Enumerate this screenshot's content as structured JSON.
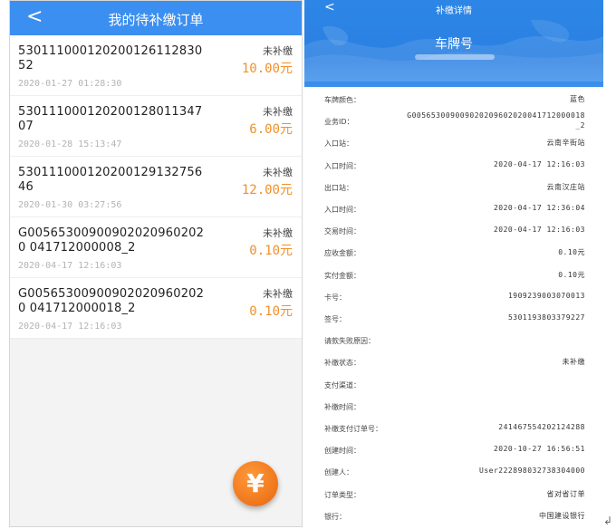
{
  "left": {
    "back_glyph": "<",
    "title": "我的待补缴订单",
    "orders": [
      {
        "id": "530111000120200126112830 52",
        "time": "2020-01-27 01:28:30",
        "status": "未补缴",
        "amount": "10.00元"
      },
      {
        "id": "530111000120200128011347 07",
        "time": "2020-01-28 15:13:47",
        "status": "未补缴",
        "amount": "6.00元"
      },
      {
        "id": "530111000120200129132756 46",
        "time": "2020-01-30 03:27:56",
        "status": "未补缴",
        "amount": "12.00元"
      },
      {
        "id": "G005653009009020209602020 041712000008_2",
        "time": "2020-04-17 12:16:03",
        "status": "未补缴",
        "amount": "0.10元"
      },
      {
        "id": "G005653009009020209602020 041712000018_2",
        "time": "2020-04-17 12:16:03",
        "status": "未补缴",
        "amount": "0.10元"
      }
    ],
    "fab_icon": "yen-icon",
    "fab_glyph": "¥",
    "accent_color": "#3b8ff0",
    "amount_color": "#f0902a"
  },
  "right": {
    "back_glyph": "<",
    "title": "补缴详情",
    "plate_heading": "车牌号",
    "details": [
      {
        "label": "车牌颜色：",
        "value": "蓝色"
      },
      {
        "label": "业务ID：",
        "value": "G005653009009020209602020041712000018_2"
      },
      {
        "label": "入口站：",
        "value": "云南辛街站"
      },
      {
        "label": "入口时间：",
        "value": "2020-04-17 12:16:03"
      },
      {
        "label": "出口站：",
        "value": "云南汉庄站"
      },
      {
        "label": "入口时间：",
        "value": "2020-04-17 12:36:04"
      },
      {
        "label": "交易时间：",
        "value": "2020-04-17 12:16:03"
      },
      {
        "label": "应收金额：",
        "value": "0.10元"
      },
      {
        "label": "实付金额：",
        "value": "0.10元"
      },
      {
        "label": "卡号：",
        "value": "1909239003070013"
      },
      {
        "label": "签号：",
        "value": "5301193803379227"
      },
      {
        "label": "请款失败原因：",
        "value": ""
      },
      {
        "label": "补缴状态：",
        "value": "未补缴"
      },
      {
        "label": "支付渠道：",
        "value": ""
      },
      {
        "label": "补缴时间：",
        "value": ""
      },
      {
        "label": "补缴支付订单号：",
        "value": "241467554202124288"
      },
      {
        "label": "创建时间：",
        "value": "2020-10-27 16:56:51"
      },
      {
        "label": "创建人：",
        "value": "User222898032738304000"
      },
      {
        "label": "订单类型：",
        "value": "省对省订单"
      },
      {
        "label": "银行：",
        "value": "中国建设银行"
      }
    ],
    "header_color": "#2d86e6"
  }
}
